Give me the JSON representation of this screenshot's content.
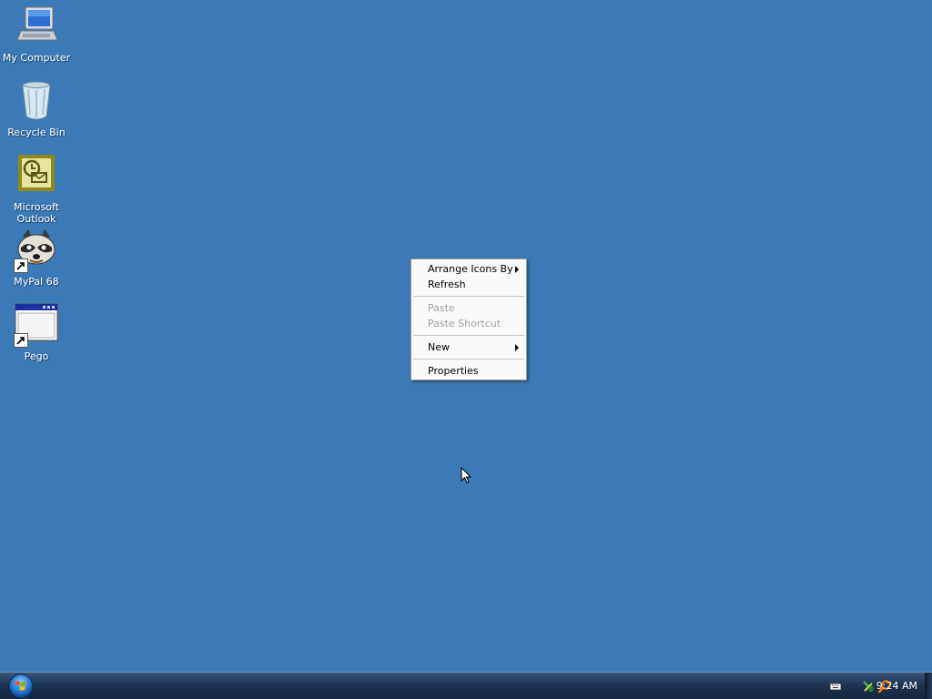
{
  "desktop": {
    "background_color": "#3c7ab7",
    "icons": [
      {
        "label": "My Computer",
        "icon": "computer-icon"
      },
      {
        "label": "Recycle Bin",
        "icon": "recycle-bin-icon"
      },
      {
        "label": "Microsoft Outlook",
        "icon": "outlook-icon"
      },
      {
        "label": "MyPal 68",
        "icon": "raccoon-icon",
        "shortcut": true
      },
      {
        "label": "Pego",
        "icon": "window-icon",
        "shortcut": true
      }
    ]
  },
  "context_menu": {
    "items": [
      {
        "label": "Arrange Icons By",
        "submenu": true,
        "enabled": true
      },
      {
        "label": "Refresh",
        "enabled": true
      },
      {
        "label": "Paste",
        "enabled": false
      },
      {
        "label": "Paste Shortcut",
        "enabled": false
      },
      {
        "label": "New",
        "submenu": true,
        "enabled": true
      },
      {
        "label": "Properties",
        "enabled": true
      }
    ]
  },
  "taskbar": {
    "start_icon": "windows-orb-icon",
    "tray_icons": [
      "keyboard-icon",
      "network-icon",
      "search-icon"
    ],
    "clock": "9:24 AM"
  }
}
